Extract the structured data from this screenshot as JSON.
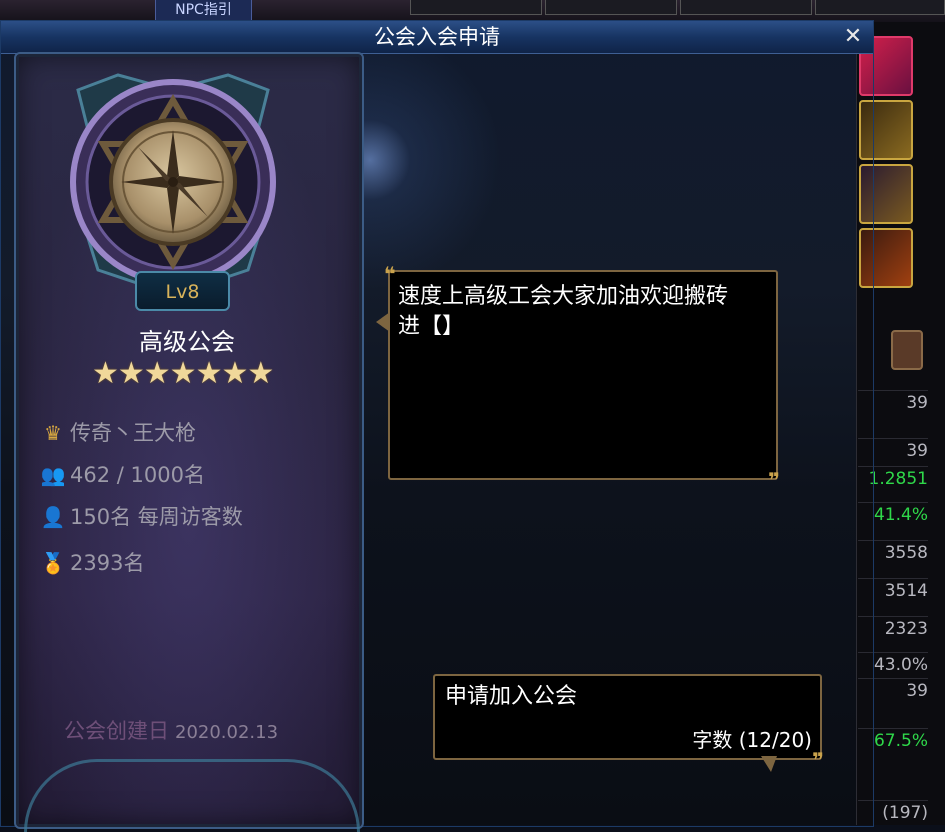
{
  "top_bar": {
    "npc_label": "NPC指引"
  },
  "dialog": {
    "title": "公会入会申请",
    "close_label": "✕"
  },
  "guild": {
    "level": "Lv8",
    "name": "高级公会",
    "stars": "★★★★★★★",
    "leader": "传奇丶王大枪",
    "members": "462 / 1000名",
    "weekly_visitors": "150名 每周访客数",
    "rank": "2393名",
    "founded_label": "公会创建日",
    "founded_date": "2020.02.13"
  },
  "message": {
    "text": "速度上高级工会大家加油欢迎搬砖进【】"
  },
  "application": {
    "text": "申请加入公会",
    "counter": "字数 (12/20)"
  },
  "side_stats": [
    "39",
    "39",
    "1.2851",
    "41.4%",
    "3558",
    "3514",
    "2323",
    "43.0%",
    "39",
    "67.5%",
    "(197)"
  ],
  "colors": {
    "title_bar": "#173462",
    "bubble_border": "#7d6540",
    "level_text": "#d8b35a",
    "green_stat": "#2fd84a"
  },
  "icons": [
    "crown-icon",
    "members-icon",
    "visitor-icon",
    "medal-icon",
    "close-icon"
  ]
}
